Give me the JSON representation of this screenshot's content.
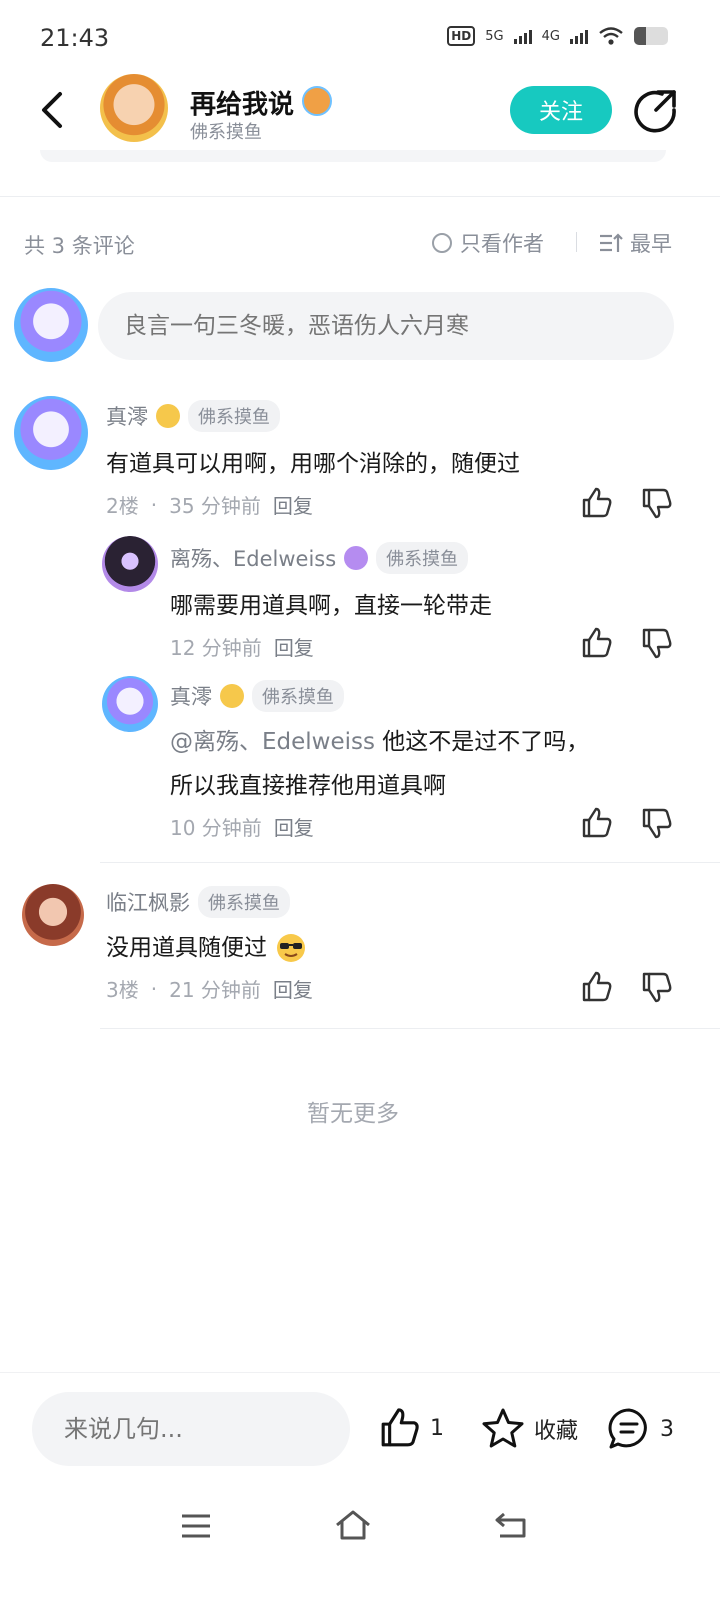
{
  "status": {
    "time": "21:43",
    "hd": "HD",
    "net1": "5G",
    "net2": "4G",
    "battery_level": 0.35
  },
  "header": {
    "title": "再给我说",
    "subtitle": "佛系摸鱼",
    "follow": "关注"
  },
  "comments_meta": {
    "count_label": "共 3 条评论",
    "only_author": "只看作者",
    "sort": "最早"
  },
  "comment_input": {
    "placeholder": "良言一句三冬暖，恶语伤人六月寒"
  },
  "comments": [
    {
      "user": "真澪",
      "tag": "佛系摸鱼",
      "text": "有道具可以用啊，用哪个消除的，随便过",
      "floor": "2楼",
      "dot": "·",
      "time": "35 分钟前",
      "reply": "回复",
      "replies": [
        {
          "user": "离殇、Edelweiss",
          "tag": "佛系摸鱼",
          "text": "哪需要用道具啊，直接一轮带走",
          "time": "12 分钟前",
          "reply": "回复"
        },
        {
          "user": "真澪",
          "tag": "佛系摸鱼",
          "mention": "@离殇、Edelweiss",
          "text": " 他这不是过不了吗，",
          "text2": "所以我直接推荐他用道具啊",
          "time": "10 分钟前",
          "reply": "回复"
        }
      ]
    },
    {
      "user": "临江枫影",
      "tag": "佛系摸鱼",
      "text": "没用道具随便过",
      "floor": "3楼",
      "dot": "·",
      "time": "21 分钟前",
      "reply": "回复"
    }
  ],
  "no_more": "暂无更多",
  "bottom": {
    "placeholder": "来说几句...",
    "likes": "1",
    "favorite": "收藏",
    "comments": "3"
  },
  "colors": {
    "accent": "#17c9c0"
  }
}
